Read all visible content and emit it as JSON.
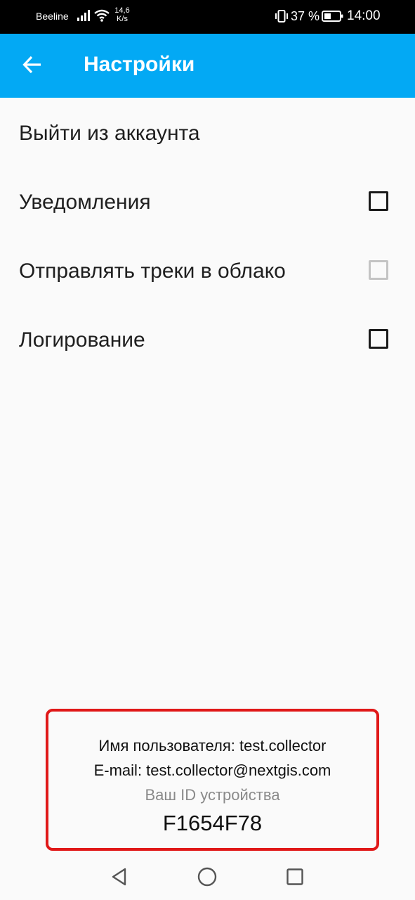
{
  "status_bar": {
    "carrier": "Beeline",
    "speed_value": "14,6",
    "speed_unit": "K/s",
    "battery_percent": "37 %",
    "time": "14:00",
    "icons": [
      "signal-icon",
      "wifi-icon",
      "vibrate-icon",
      "battery-icon"
    ]
  },
  "app_bar": {
    "title": "Настройки",
    "back_icon": "arrow-left-icon",
    "color": "#03a9f4"
  },
  "settings": {
    "logout_label": "Выйти из аккаунта",
    "notifications": {
      "label": "Уведомления",
      "checked": false,
      "enabled": true
    },
    "cloud_tracks": {
      "label": "Отправлять треки в облако",
      "checked": false,
      "enabled": false
    },
    "logging": {
      "label": "Логирование",
      "checked": false,
      "enabled": true
    }
  },
  "info": {
    "username_line": "Имя пользователя: test.collector",
    "email_line": "E-mail: test.collector@nextgis.com",
    "device_id_label": "Ваш ID устройства",
    "device_id": "F1654F78",
    "highlight_color": "#e01818"
  },
  "nav_bar": {
    "buttons": [
      "back-triangle-icon",
      "home-circle-icon",
      "recents-square-icon"
    ]
  }
}
